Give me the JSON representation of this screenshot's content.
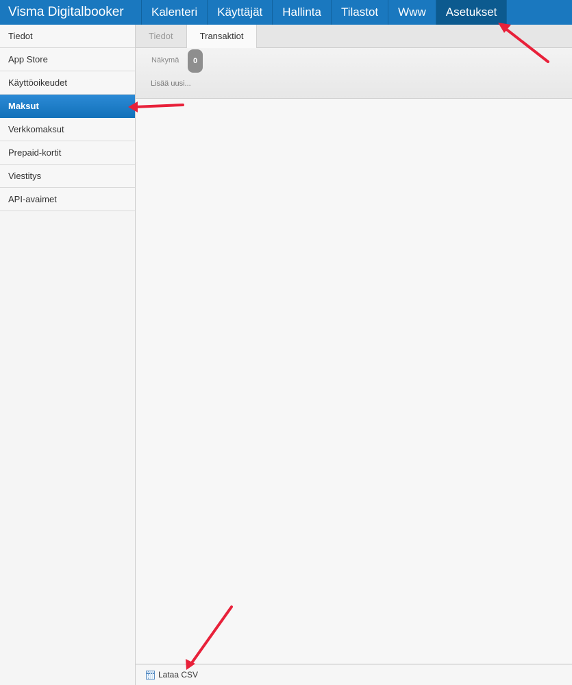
{
  "header": {
    "brand": "Visma Digitalbooker",
    "nav": [
      {
        "label": "Kalenteri",
        "active": false
      },
      {
        "label": "Käyttäjät",
        "active": false
      },
      {
        "label": "Hallinta",
        "active": false
      },
      {
        "label": "Tilastot",
        "active": false
      },
      {
        "label": "Www",
        "active": false
      },
      {
        "label": "Asetukset",
        "active": true
      }
    ]
  },
  "sidebar": {
    "items": [
      {
        "label": "Tiedot",
        "active": false
      },
      {
        "label": "App Store",
        "active": false
      },
      {
        "label": "Käyttöoikeudet",
        "active": false
      },
      {
        "label": "Maksut",
        "active": true
      },
      {
        "label": "Verkkomaksut",
        "active": false
      },
      {
        "label": "Prepaid-kortit",
        "active": false
      },
      {
        "label": "Viestitys",
        "active": false
      },
      {
        "label": "API-avaimet",
        "active": false
      }
    ]
  },
  "main": {
    "tabs": [
      {
        "label": "Tiedot",
        "active": false
      },
      {
        "label": "Transaktiot",
        "active": true
      }
    ],
    "toolbar": {
      "view_label": "Näkymä",
      "count": "0",
      "add_new": "Lisää uusi..."
    },
    "footer": {
      "csv_label": "Lataa CSV",
      "csv_icon": "spreadsheet-icon"
    }
  },
  "annotations": {
    "arrow_color": "#e8213a"
  },
  "colors": {
    "accent": "#1a78bf",
    "nav_active": "#0c5a8f",
    "sidebar_active": "#1272ba"
  }
}
